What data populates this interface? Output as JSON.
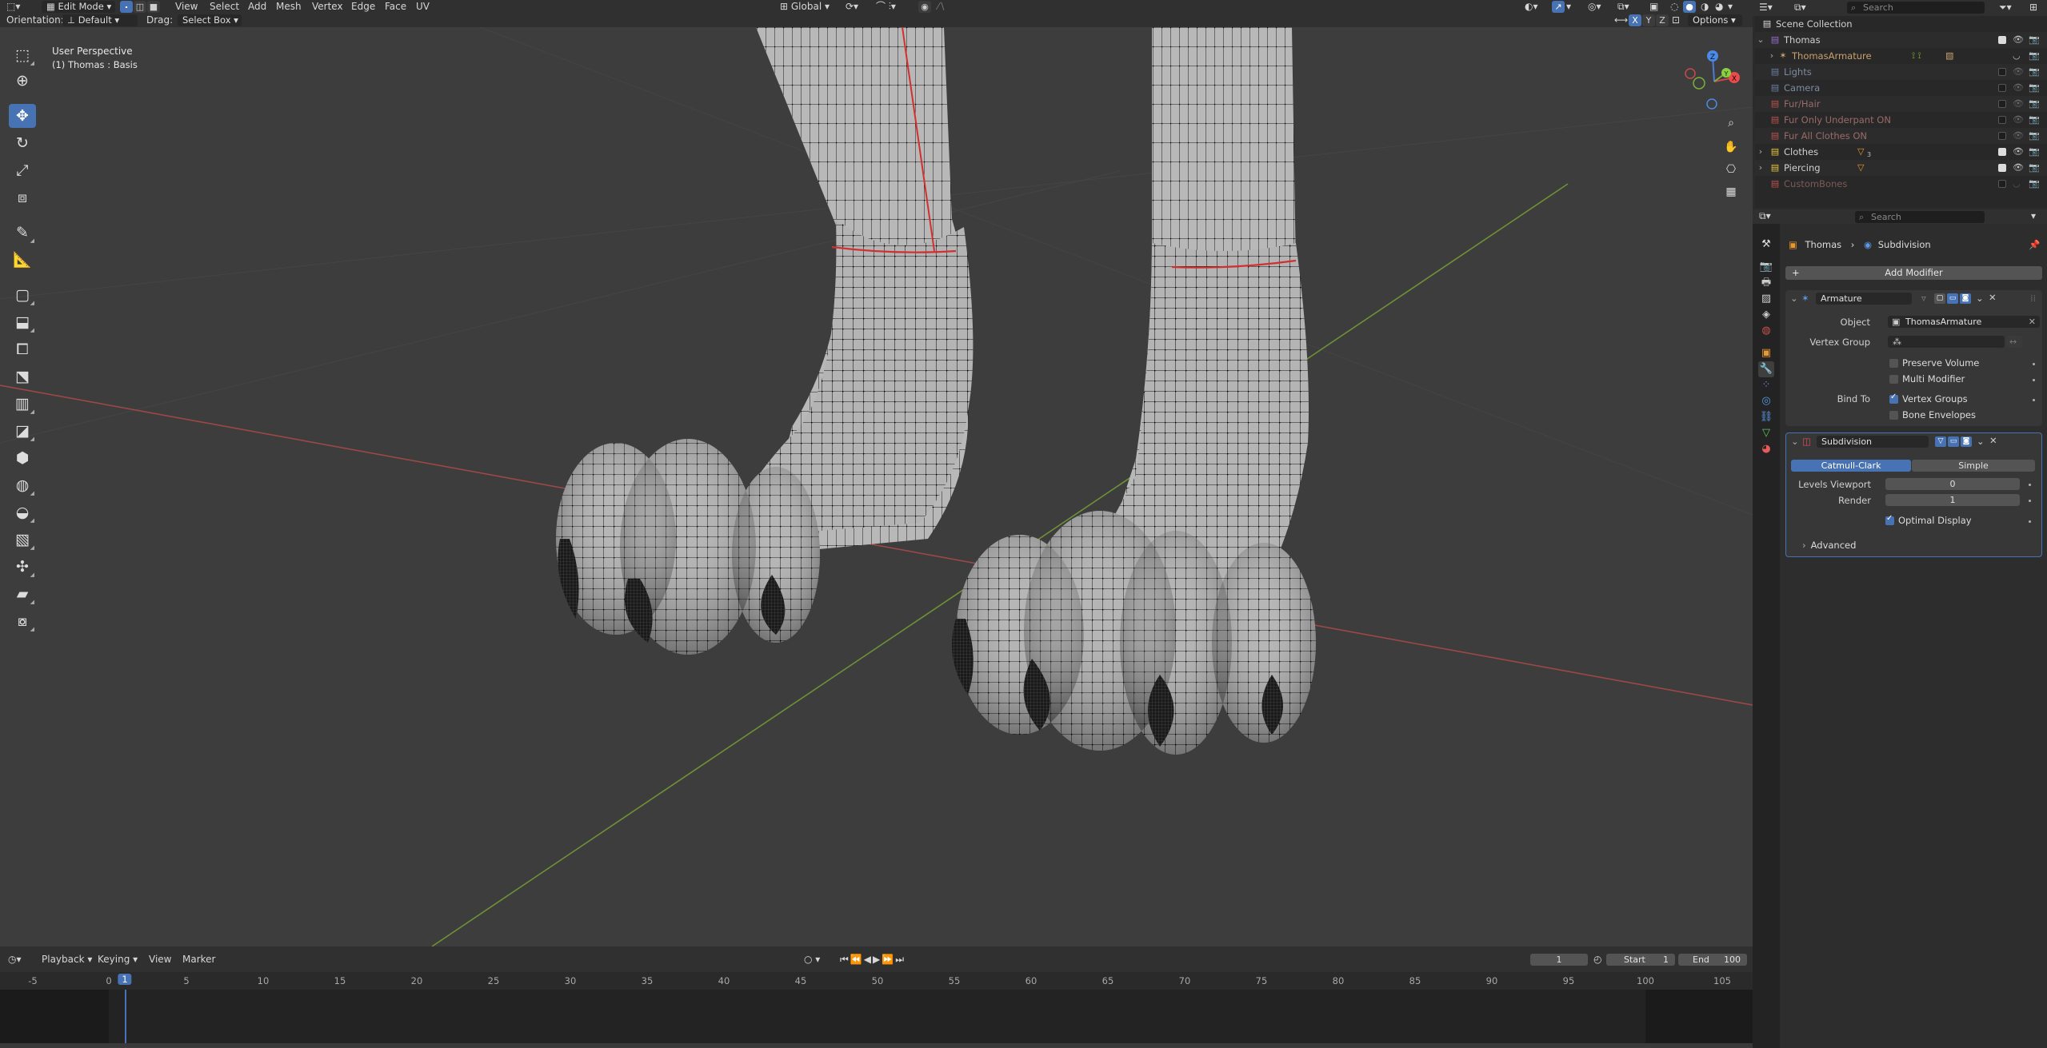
{
  "header": {
    "mode": "Edit Mode",
    "menus": [
      "View",
      "Select",
      "Add",
      "Mesh",
      "Vertex",
      "Edge",
      "Face",
      "UV"
    ],
    "transform_space": "Global",
    "orientation_label": "Orientation:",
    "orientation_value": "Default",
    "drag_label": "Drag:",
    "drag_value": "Select Box",
    "options_label": "Options",
    "axes": [
      "X",
      "Y",
      "Z"
    ]
  },
  "viewport": {
    "perspective": "User Perspective",
    "object_info": "(1) Thomas : Basis",
    "gizmo": {
      "x": "X",
      "y": "Y",
      "z": "Z"
    }
  },
  "timeline": {
    "menus": [
      "Playback",
      "Keying",
      "View",
      "Marker"
    ],
    "current_frame": "1",
    "start_label": "Start",
    "start_value": "1",
    "end_label": "End",
    "end_value": "100",
    "ruler": [
      "-5",
      "0",
      "1",
      "5",
      "10",
      "15",
      "20",
      "25",
      "30",
      "35",
      "40",
      "45",
      "50",
      "55",
      "60",
      "65",
      "70",
      "75",
      "80",
      "85",
      "90",
      "95",
      "100",
      "105"
    ]
  },
  "outliner": {
    "search_placeholder": "Search",
    "scene_collection": "Scene Collection",
    "items": [
      {
        "label": "Thomas",
        "color": "#9b6cd6"
      },
      {
        "label": "ThomasArmature",
        "color": "#c8a070"
      },
      {
        "label": "Lights",
        "color": "#6b7fa3"
      },
      {
        "label": "Camera",
        "color": "#6b7fa3"
      },
      {
        "label": "Fur/Hair",
        "color": "#c05050"
      },
      {
        "label": "Fur Only Underpant ON",
        "color": "#c05050"
      },
      {
        "label": "Fur All Clothes ON",
        "color": "#c05050"
      },
      {
        "label": "Clothes",
        "color": "#e8c840"
      },
      {
        "label": "Piercing",
        "color": "#e8c840"
      },
      {
        "label": "CustomBones",
        "color": "#c05050"
      }
    ],
    "clothes_badge": "3"
  },
  "properties": {
    "search_placeholder": "Search",
    "breadcrumb_object": "Thomas",
    "breadcrumb_modifier": "Subdivision",
    "add_modifier": "Add Modifier",
    "armature": {
      "name": "Armature",
      "object_label": "Object",
      "object_value": "ThomasArmature",
      "vertex_group_label": "Vertex Group",
      "preserve_volume": "Preserve Volume",
      "multi_modifier": "Multi Modifier",
      "bind_to_label": "Bind To",
      "vertex_groups": "Vertex Groups",
      "bone_envelopes": "Bone Envelopes"
    },
    "subdivision": {
      "name": "Subdivision",
      "catmull": "Catmull-Clark",
      "simple": "Simple",
      "levels_viewport_label": "Levels Viewport",
      "levels_viewport_value": "0",
      "render_label": "Render",
      "render_value": "1",
      "optimal_display": "Optimal Display",
      "advanced": "Advanced"
    }
  },
  "colors": {
    "accent": "#4772b3",
    "x_axis": "#b34b4b",
    "y_axis": "#7ea63a"
  }
}
